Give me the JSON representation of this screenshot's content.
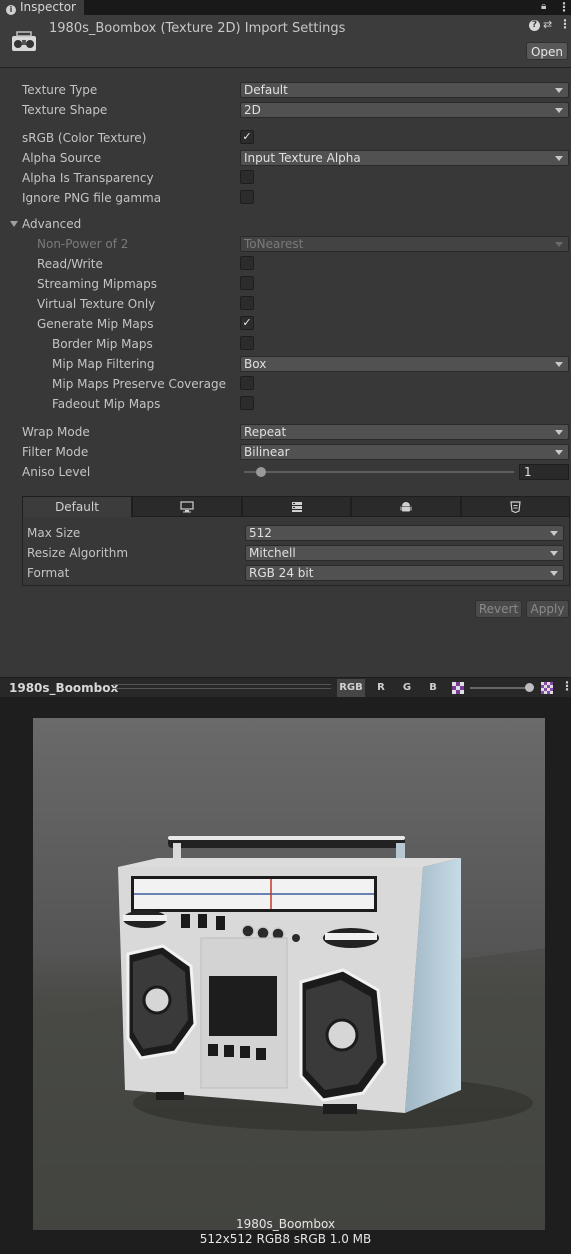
{
  "tab": {
    "label": "Inspector"
  },
  "header": {
    "title": "1980s_Boombox (Texture 2D) Import Settings",
    "open_label": "Open"
  },
  "rows": {
    "texture_type": {
      "label": "Texture Type",
      "value": "Default"
    },
    "texture_shape": {
      "label": "Texture Shape",
      "value": "2D"
    },
    "srgb": {
      "label": "sRGB (Color Texture)",
      "checked": true
    },
    "alpha_source": {
      "label": "Alpha Source",
      "value": "Input Texture Alpha"
    },
    "alpha_transparency": {
      "label": "Alpha Is Transparency",
      "checked": false
    },
    "ignore_png": {
      "label": "Ignore PNG file gamma",
      "checked": false
    },
    "advanced": {
      "label": "Advanced"
    },
    "non_power": {
      "label": "Non-Power of 2",
      "value": "ToNearest"
    },
    "read_write": {
      "label": "Read/Write",
      "checked": false
    },
    "streaming": {
      "label": "Streaming Mipmaps",
      "checked": false
    },
    "virtual_tex": {
      "label": "Virtual Texture Only",
      "checked": false
    },
    "gen_mip": {
      "label": "Generate Mip Maps",
      "checked": true
    },
    "border_mip": {
      "label": "Border Mip Maps",
      "checked": false
    },
    "mip_filter": {
      "label": "Mip Map Filtering",
      "value": "Box"
    },
    "mip_coverage": {
      "label": "Mip Maps Preserve Coverage",
      "checked": false
    },
    "fadeout": {
      "label": "Fadeout Mip Maps",
      "checked": false
    },
    "wrap_mode": {
      "label": "Wrap Mode",
      "value": "Repeat"
    },
    "filter_mode": {
      "label": "Filter Mode",
      "value": "Bilinear"
    },
    "aniso": {
      "label": "Aniso Level",
      "value": "1"
    }
  },
  "platform": {
    "tabs": [
      {
        "label": "Default",
        "icon": ""
      },
      {
        "label": "",
        "icon": "monitor-icon"
      },
      {
        "label": "",
        "icon": "server-icon"
      },
      {
        "label": "",
        "icon": "android-icon"
      },
      {
        "label": "",
        "icon": "html5-icon"
      }
    ],
    "max_size": {
      "label": "Max Size",
      "value": "512"
    },
    "resize": {
      "label": "Resize Algorithm",
      "value": "Mitchell"
    },
    "format": {
      "label": "Format",
      "value": "RGB 24 bit"
    }
  },
  "actions": {
    "revert": "Revert",
    "apply": "Apply"
  },
  "preview": {
    "title": "1980s_Boombox",
    "channels": [
      "RGB",
      "R",
      "G",
      "B"
    ],
    "caption_name": "1980s_Boombox",
    "caption_info": "512x512  RGB8 sRGB  1.0 MB"
  },
  "colors": {
    "panel": "#383838",
    "header": "#3c3c3c",
    "field": "#515151",
    "preview_bg": "#1e1e1e"
  }
}
